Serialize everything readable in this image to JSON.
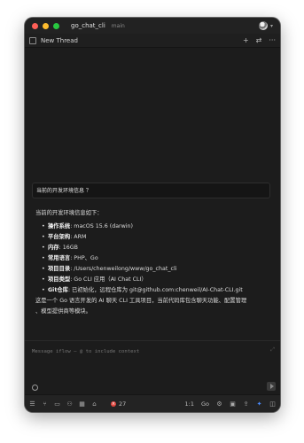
{
  "window": {
    "project": "go_chat_cli",
    "branch": "main"
  },
  "tab": {
    "title": "New Thread",
    "actions": [
      "+",
      "⇄",
      "···"
    ]
  },
  "conversation": {
    "query": "当前的开发环境信息 ？",
    "intro": "当前的开发环境信息如下：",
    "items": [
      {
        "key": "操作系统",
        "value": ": macOS 15.6 (darwin)"
      },
      {
        "key": "平台架构",
        "value": ": ARM"
      },
      {
        "key": "内存",
        "value": ": 16GB"
      },
      {
        "key": "常用语言",
        "value": ": PHP、Go"
      },
      {
        "key": "项目目录",
        "value": ": /Users/chenweilong/www/go_chat_cli"
      },
      {
        "key": "项目类型",
        "value": ": Go CLI 应用（AI Chat CLI）"
      },
      {
        "key": "Git仓库",
        "value": ": 已初始化，远程仓库为 git@github.com:chenweil/AI-Chat-CLI.git"
      }
    ],
    "summary_line1": "这是一个 Go 语言开发的 AI 聊天 CLI 工具项目，当前代码库包含聊天功能、配置管理",
    "summary_line2": "、模型提供商等模块。"
  },
  "composer": {
    "placeholder": "Message iflow — @ to include context"
  },
  "statusbar": {
    "errors": "27",
    "position": "1:1",
    "language": "Go"
  }
}
